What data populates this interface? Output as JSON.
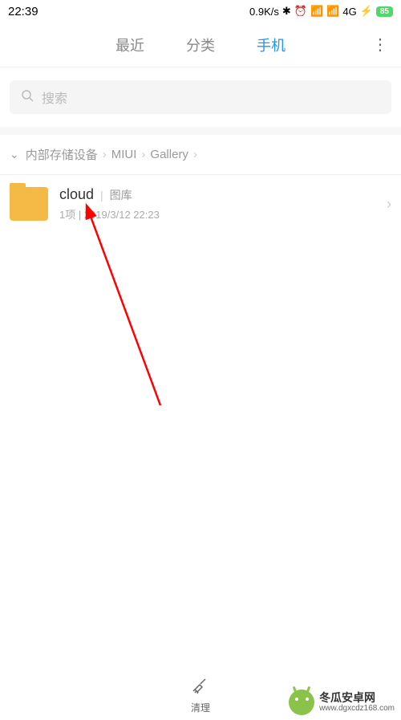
{
  "status": {
    "time": "22:39",
    "speed": "0.9K/s",
    "network": "4G",
    "battery": "85"
  },
  "tabs": {
    "items": [
      "最近",
      "分类",
      "手机"
    ],
    "active_index": 2
  },
  "search": {
    "placeholder": "搜索"
  },
  "breadcrumb": {
    "items": [
      "内部存储设备",
      "MIUI",
      "Gallery"
    ]
  },
  "files": [
    {
      "name": "cloud",
      "tag": "图库",
      "count": "1项",
      "date": "2019/3/12 22:23"
    }
  ],
  "bottom": {
    "clean_label": "清理"
  },
  "watermark": {
    "name": "冬瓜安卓网",
    "url": "www.dgxcdz168.com"
  }
}
